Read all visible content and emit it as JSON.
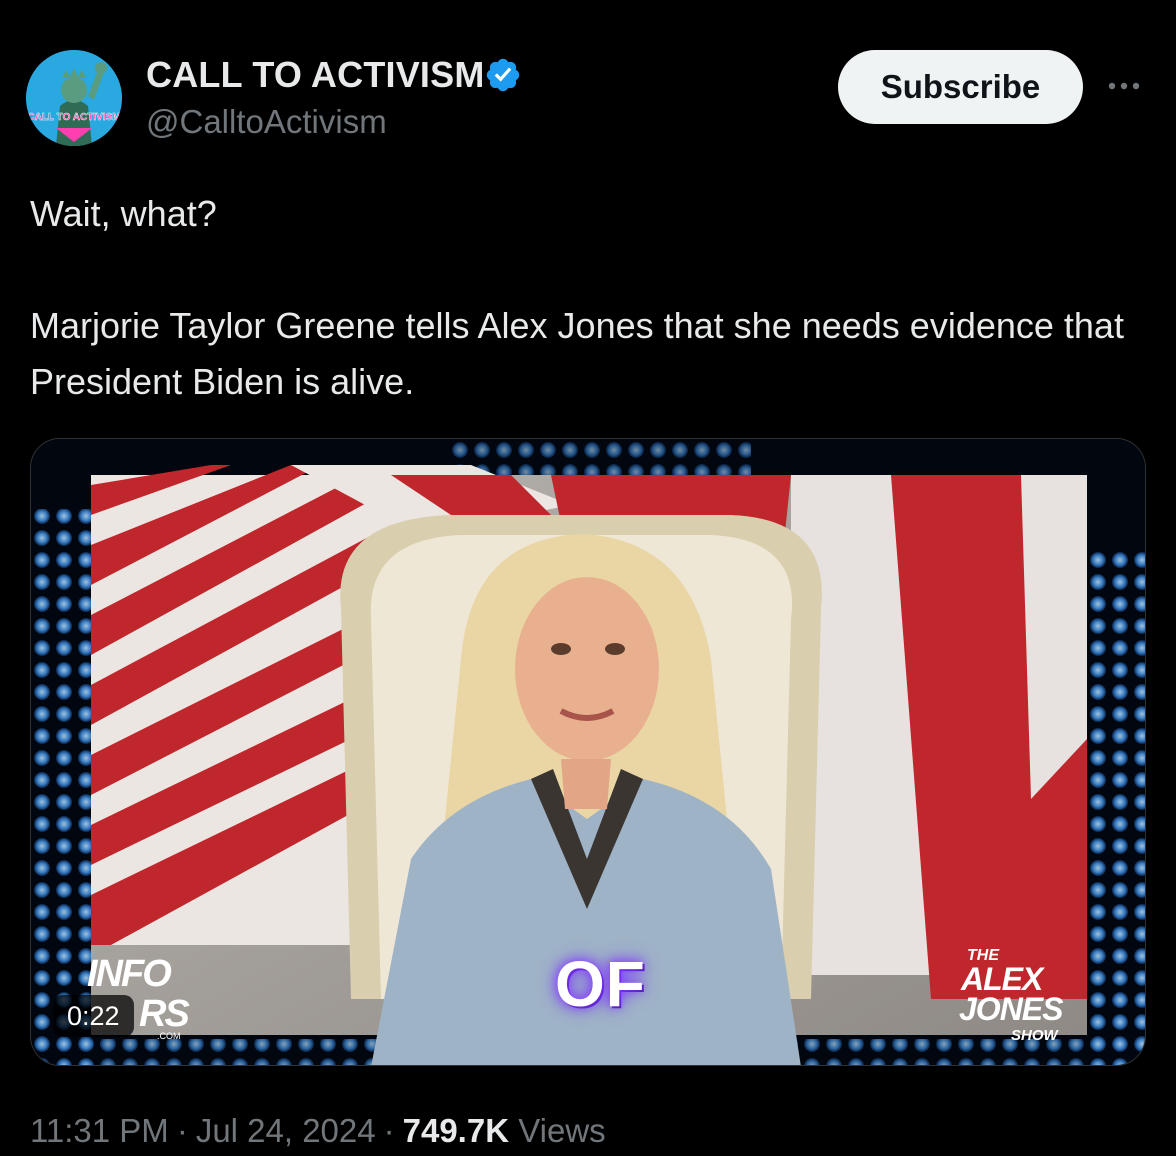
{
  "author": {
    "display_name": "CALL TO ACTIVISM",
    "handle": "@CalltoActivism",
    "avatar_text": "CALL TO ACTIVISM",
    "verified": true,
    "verified_color": "#1d9bf0"
  },
  "actions": {
    "subscribe_label": "Subscribe",
    "more_icon": "more-horizontal-icon"
  },
  "tweet": {
    "paragraphs": [
      "Wait, what?",
      "Marjorie Taylor Greene tells Alex Jones that she needs evidence that President Biden is alive."
    ]
  },
  "media": {
    "type": "video",
    "duration_label": "0:22",
    "caption": "OF",
    "watermark_left": {
      "line1": "INFO",
      "line2": "RS",
      "small": ".COM"
    },
    "watermark_right": {
      "the": "THE",
      "alex": "ALEX",
      "jones": "JONES",
      "show": "SHOW"
    }
  },
  "meta": {
    "time": "11:31 PM",
    "date": "Jul 24, 2024",
    "views_count": "749.7K",
    "views_label": "Views"
  },
  "colors": {
    "background": "#000000",
    "text_primary": "#e7e9ea",
    "text_secondary": "#71767b",
    "subscribe_bg": "#eff3f4"
  }
}
